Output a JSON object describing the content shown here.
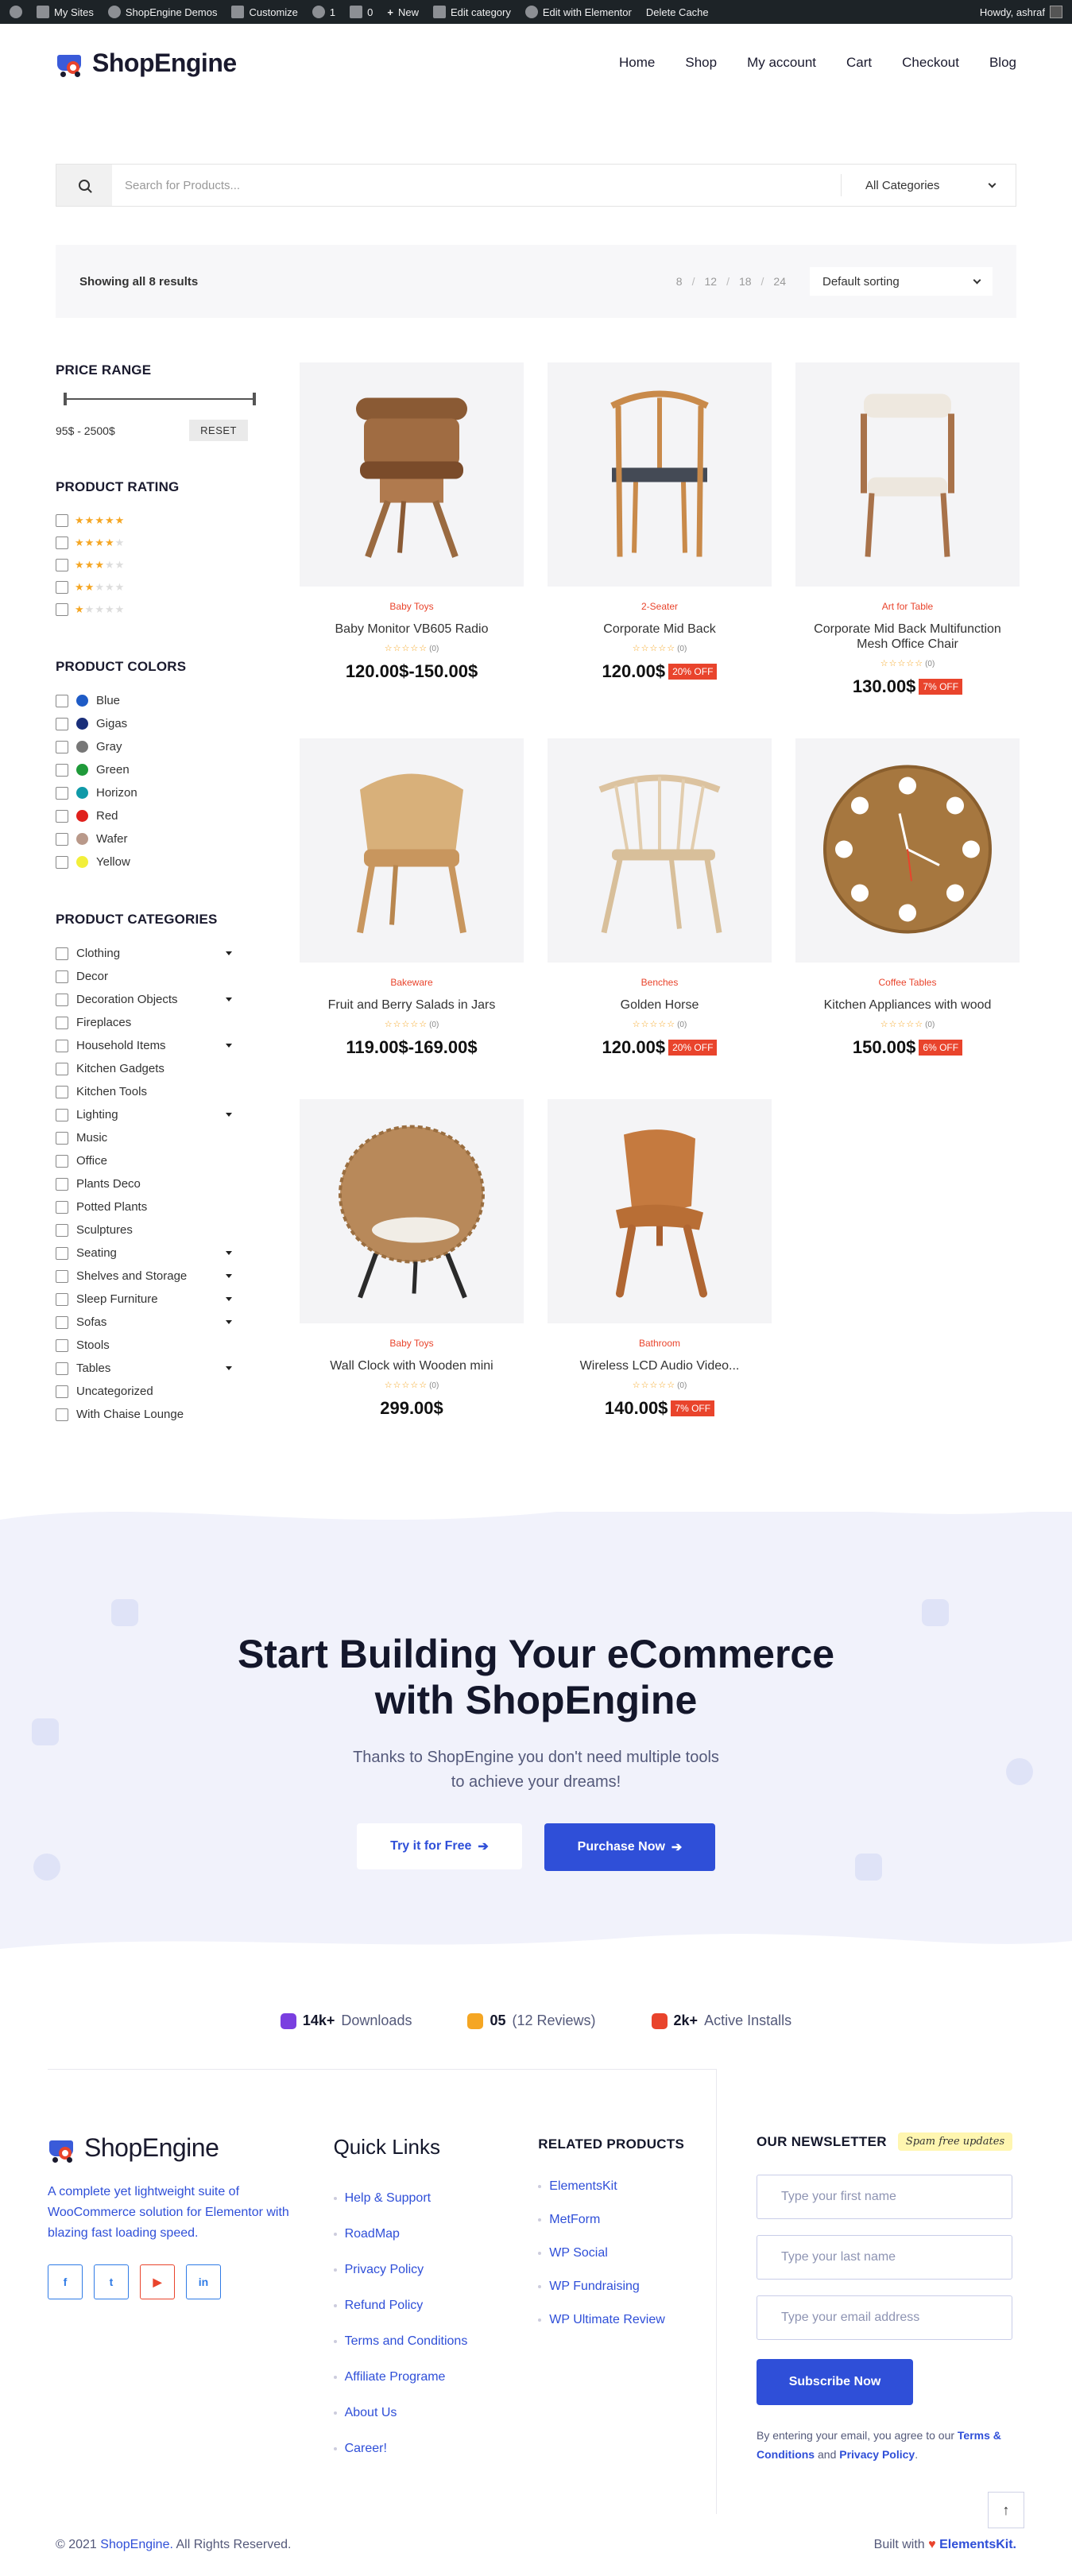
{
  "admin_bar": {
    "items": [
      "My Sites",
      "ShopEngine Demos",
      "Customize",
      "1",
      "0",
      "New",
      "Edit category",
      "Edit with Elementor",
      "Delete Cache"
    ],
    "greeting": "Howdy, ashraf"
  },
  "header": {
    "logo_text": "ShopEngine",
    "nav": [
      "Home",
      "Shop",
      "My account",
      "Cart",
      "Checkout",
      "Blog"
    ]
  },
  "search": {
    "placeholder": "Search for Products...",
    "category": "All Categories"
  },
  "toolbar": {
    "results": "Showing all 8 results",
    "per_page": [
      "8",
      "12",
      "18",
      "24"
    ],
    "sorting": "Default sorting"
  },
  "sidebar": {
    "price_title": "PRICE RANGE",
    "price_value": "95$ - 2500$",
    "reset": "RESET",
    "rating_title": "PRODUCT RATING",
    "ratings": [
      5,
      4,
      3,
      2,
      1
    ],
    "colors_title": "PRODUCT COLORS",
    "colors": [
      {
        "name": "Blue",
        "hex": "#1e5bc6"
      },
      {
        "name": "Gigas",
        "hex": "#1a2f7a"
      },
      {
        "name": "Gray",
        "hex": "#777777"
      },
      {
        "name": "Green",
        "hex": "#1f9a3a"
      },
      {
        "name": "Horizon",
        "hex": "#0f9aa8"
      },
      {
        "name": "Red",
        "hex": "#e0201c"
      },
      {
        "name": "Wafer",
        "hex": "#b9998a"
      },
      {
        "name": "Yellow",
        "hex": "#f2ef3a"
      }
    ],
    "categories_title": "PRODUCT CATEGORIES",
    "categories": [
      {
        "name": "Clothing",
        "sub": true
      },
      {
        "name": "Decor",
        "sub": false
      },
      {
        "name": "Decoration Objects",
        "sub": true
      },
      {
        "name": "Fireplaces",
        "sub": false
      },
      {
        "name": "Household Items",
        "sub": true
      },
      {
        "name": "Kitchen Gadgets",
        "sub": false
      },
      {
        "name": "Kitchen Tools",
        "sub": false
      },
      {
        "name": "Lighting",
        "sub": true
      },
      {
        "name": "Music",
        "sub": false
      },
      {
        "name": "Office",
        "sub": false
      },
      {
        "name": "Plants Deco",
        "sub": false
      },
      {
        "name": "Potted Plants",
        "sub": false
      },
      {
        "name": "Sculptures",
        "sub": false
      },
      {
        "name": "Seating",
        "sub": true
      },
      {
        "name": "Shelves and Storage",
        "sub": true
      },
      {
        "name": "Sleep Furniture",
        "sub": true
      },
      {
        "name": "Sofas",
        "sub": true
      },
      {
        "name": "Stools",
        "sub": false
      },
      {
        "name": "Tables",
        "sub": true
      },
      {
        "name": "Uncategorized",
        "sub": false
      },
      {
        "name": "With Chaise Lounge",
        "sub": false
      }
    ]
  },
  "products": [
    {
      "category": "Baby Toys",
      "title": "Baby Monitor VB605 Radio",
      "rating_count": "(0)",
      "price": "120.00$-150.00$",
      "badge": "",
      "image": "swivel-leather-chair"
    },
    {
      "category": "2-Seater",
      "title": "Corporate Mid Back",
      "rating_count": "(0)",
      "price": "120.00$",
      "badge": "20% OFF",
      "image": "wishbone-chair"
    },
    {
      "category": "Art for Table",
      "title": "Corporate Mid Back Multifunction Mesh Office Chair",
      "rating_count": "(0)",
      "price": "130.00$",
      "badge": "7% OFF",
      "image": "armchair-white"
    },
    {
      "category": "Bakeware",
      "title": "Fruit and Berry Salads in Jars",
      "rating_count": "(0)",
      "price": "119.00$-169.00$",
      "badge": "",
      "image": "rattan-chair"
    },
    {
      "category": "Benches",
      "title": "Golden Horse",
      "rating_count": "(0)",
      "price": "120.00$",
      "badge": "20% OFF",
      "image": "spindle-chair"
    },
    {
      "category": "Coffee Tables",
      "title": "Kitchen Appliances with wood",
      "rating_count": "(0)",
      "price": "150.00$",
      "badge": "6% OFF",
      "image": "wooden-clock"
    },
    {
      "category": "Baby Toys",
      "title": "Wall Clock with Wooden mini",
      "rating_count": "(0)",
      "price": "299.00$",
      "badge": "",
      "image": "wicker-egg-chair"
    },
    {
      "category": "Bathroom",
      "title": "Wireless LCD Audio Video...",
      "rating_count": "(0)",
      "price": "140.00$",
      "badge": "7% OFF",
      "image": "plywood-lounge-chair"
    }
  ],
  "cta": {
    "title_line1": "Start Building Your eCommerce",
    "title_line2": "with ShopEngine",
    "subtitle_line1": "Thanks to ShopEngine you don't need multiple tools",
    "subtitle_line2": "to achieve your dreams!",
    "btn_free": "Try it for Free",
    "btn_buy": "Purchase Now"
  },
  "stats": [
    {
      "bold": "14k+",
      "text": "Downloads",
      "color": "#7a3fe0"
    },
    {
      "bold": "05",
      "text": "(12 Reviews)",
      "color": "#f5a623"
    },
    {
      "bold": "2k+",
      "text": "Active Installs",
      "color": "#e9442c"
    }
  ],
  "footer": {
    "logo_text": "ShopEngine",
    "about": "A complete yet lightweight suite of WooCommerce solution for Elementor with blazing fast loading speed.",
    "socials": [
      "f",
      "t",
      "yt",
      "in"
    ],
    "quick_links_title": "Quick Links",
    "quick_links": [
      "Help & Support",
      "RoadMap",
      "Privacy Policy",
      "Refund Policy",
      "Terms and Conditions",
      "Affiliate Programe",
      "About Us",
      "Career!"
    ],
    "related_title": "RELATED PRODUCTS",
    "related": [
      "ElementsKit",
      "MetForm",
      "WP Social",
      "WP Fundraising",
      "WP Ultimate Review"
    ],
    "newsletter_title": "OUR NEWSLETTER",
    "spam": "Spam free updates",
    "first_name": "Type your first name",
    "last_name": "Type your last name",
    "email": "Type your email address",
    "subscribe": "Subscribe Now",
    "note_pre": "By entering your email, you agree to our",
    "note_terms": "Terms & Conditions",
    "note_and": "and",
    "note_privacy": "Privacy Policy",
    "copyright_pre": "© 2021",
    "copyright_brand": "ShopEngine.",
    "copyright_post": "All Rights Reserved.",
    "built_pre": "Built with",
    "built_brand": "ElementsKit."
  }
}
